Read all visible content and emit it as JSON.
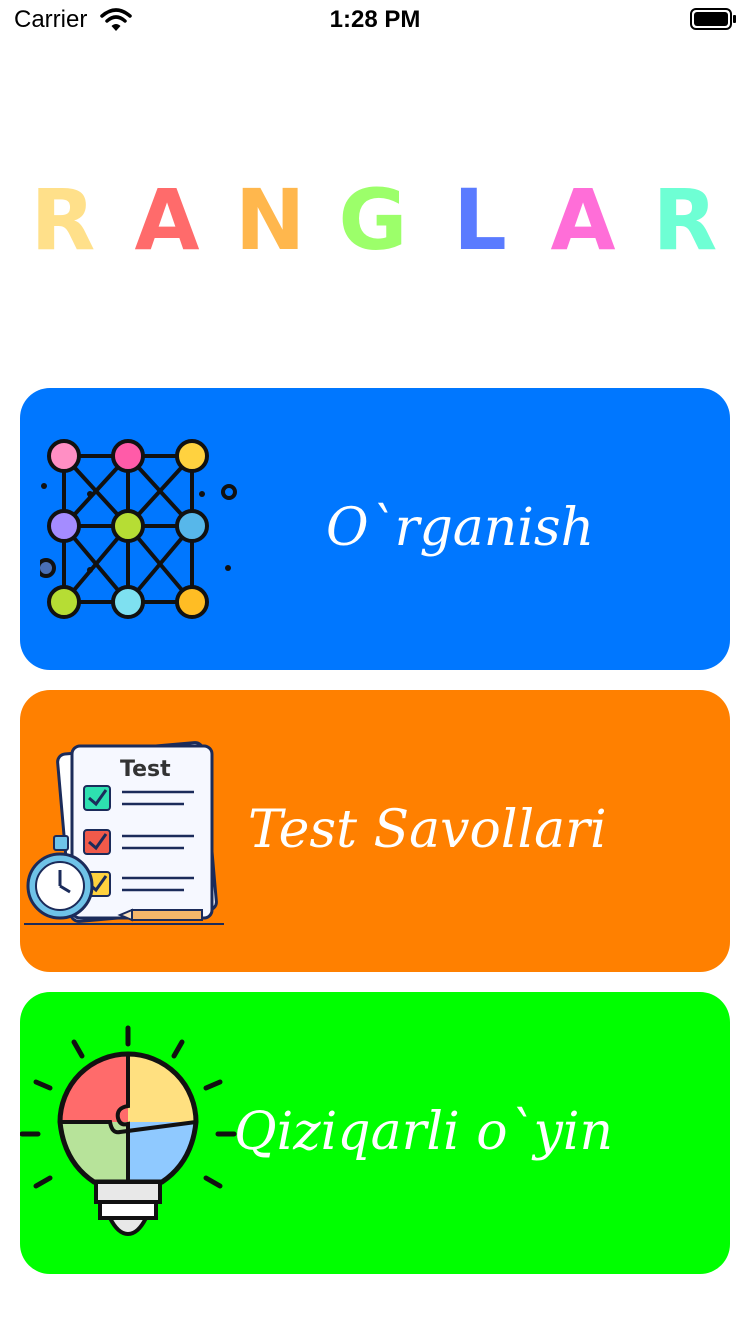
{
  "status_bar": {
    "carrier": "Carrier",
    "time": "1:28 PM"
  },
  "title": {
    "text": "RANGLAR",
    "letters": [
      {
        "char": "R",
        "color": "#ffe08a"
      },
      {
        "char": "A",
        "color": "#ff6b6b"
      },
      {
        "char": "N",
        "color": "#ffb74d"
      },
      {
        "char": "G",
        "color": "#9cff6a"
      },
      {
        "char": "L",
        "color": "#5a7bff"
      },
      {
        "char": "A",
        "color": "#ff6ed8"
      },
      {
        "char": "R",
        "color": "#6effd4"
      }
    ]
  },
  "menu": {
    "learn": {
      "label": "O`rganish",
      "color": "#0077ff",
      "icon": "network-nodes-icon"
    },
    "test": {
      "label": "Test Savollari",
      "color": "#ff8000",
      "icon": "test-sheet-icon",
      "sheet_title": "Test"
    },
    "game": {
      "label": "Qiziqarli o`yin",
      "color": "#00ff00",
      "icon": "puzzle-lightbulb-icon"
    }
  }
}
